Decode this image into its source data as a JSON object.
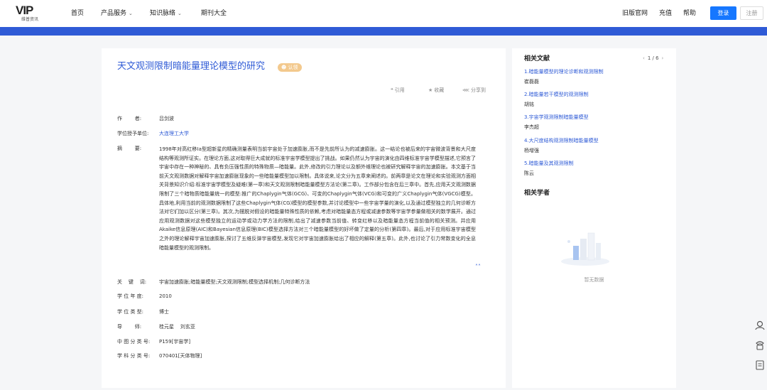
{
  "header": {
    "logo_text": "VIP",
    "logo_sub": "维普资讯",
    "nav": [
      {
        "label": "首页",
        "dropdown": false
      },
      {
        "label": "产品服务",
        "dropdown": true
      },
      {
        "label": "知识脉络",
        "dropdown": true
      },
      {
        "label": "期刊大全",
        "dropdown": false
      }
    ],
    "right_links": [
      "旧版官网",
      "充值",
      "帮助"
    ],
    "login_label": "登录",
    "register_label": "注册"
  },
  "article": {
    "title": "天文观测限制暗能量理论模型的研究",
    "badge": "认领",
    "actions": {
      "cite": "引用",
      "favorite": "收藏",
      "share": "分享到"
    },
    "meta": {
      "author_label": "作        者:",
      "author": "吕剑波",
      "unit_label": "学位授予单位:",
      "unit": "大连理工大学",
      "abstract_label": "摘        要:",
      "abstract": "1998年对高红移Ⅰa型超新星的精确测量表明当前宇宙处于加速膨胀,而不是先前所认为的减速膨胀。这一结论也被后来的宇宙微波背景和大尺度结构等观测所证实。在理论方面,这对取得巨大成就的标准宇宙学模型提出了挑战。如果仍然认为宇宙的演化由四维标准宇宙学模型描述,它预言了宇宙中存在一种神秘的、具有负压强性质的特殊物质—暗能量。此外,修改的引力理论以及额外维理论也被研究解释宇宙的加速膨胀。本文基于当前天文观测数据对解释宇宙加速膨胀现象的一些暗能量模型加以限制。具体说来,论文分为五章来阐述的。前两章是论文在理论和实验观测方面相关背景知识介绍:标准宇宙学模型及疑难(第一章)和天文观测限制暗能量模型方法论(第二章)。工作部分包含在后三章中。首先,应用天文观测数据限制了三个暗物质暗能量统一的模型:推广的Chaplygin气体(GCG)、可变的Chaplygin气体(VCG)和可变的广义Chaplygin气体(VGCG)模型。具体地,利用当前的观测数据限制了这些Chaplygin气体(CG)模型的模型参数,并讨论模型中一些宇宙学量的演化,以及通过模型独立的几何诊断方法对它们加以区分(第三章)。其次,为摆脱对假设的暗能量特殊性质的依赖,考虑对暗能量态方程或减速参数等宇宙学参量做相关的数学展开。通过应用观测数据对这些模型独立的运动学或动力学方法的限制,给出了减速参数当前值、转变红移以及暗能量态方程当前值的相关预测。并应用Akaike信息原理(AIC)和Bayesian信息原理(BIC)模型选择方法对三个暗能量模型的好坏做了定量的分析(第四章)。最后,对于应用标准宇宙模型之外的理论解释宇宙加速膨胀,探讨了五维反弹宇宙模型,发现它对宇宙加速膨胀给出了相应的解释(第五章)。此外,也讨论了引力常数变化的全息暗能量模型的观测限制。",
      "keywords_label": "关    键    词:",
      "keywords": "宇宙加速膨胀;暗能量模型;天文观测限制;模型选择机制;几何诊断方法",
      "year_label": "学 位 年 度:",
      "year": "2010",
      "degree_label": "学 位 类 型:",
      "degree": "博士",
      "advisor_label": "导        师:",
      "advisor": "桂元星    刘玄亚",
      "clc_label": "中 图 分 类 号:",
      "clc": "P159[宇宙学]",
      "subject_label": "学 科 分 类 号:",
      "subject": "070401[天体物理]"
    }
  },
  "sidebar": {
    "related_title": "相关文献",
    "pager": "1 / 6",
    "related": [
      {
        "title": "1.暗能量模型的理论诊断和观测限制",
        "author": "崔磊磊"
      },
      {
        "title": "2.暗能量若干模型的观测限制",
        "author": "胡铭"
      },
      {
        "title": "3.宇宙学观测限制暗能量模型",
        "author": "李杰超"
      },
      {
        "title": "4.大尺度结构观测限制暗能量模型",
        "author": "杨增强"
      },
      {
        "title": "5.暗能量及其观测限制",
        "author": "陈云"
      }
    ],
    "scholars_title": "相关学者",
    "empty_text": "暂无数据"
  },
  "colors": {
    "accent": "#2f5bd6",
    "login": "#1677ff",
    "badge": "#f3c98d"
  }
}
